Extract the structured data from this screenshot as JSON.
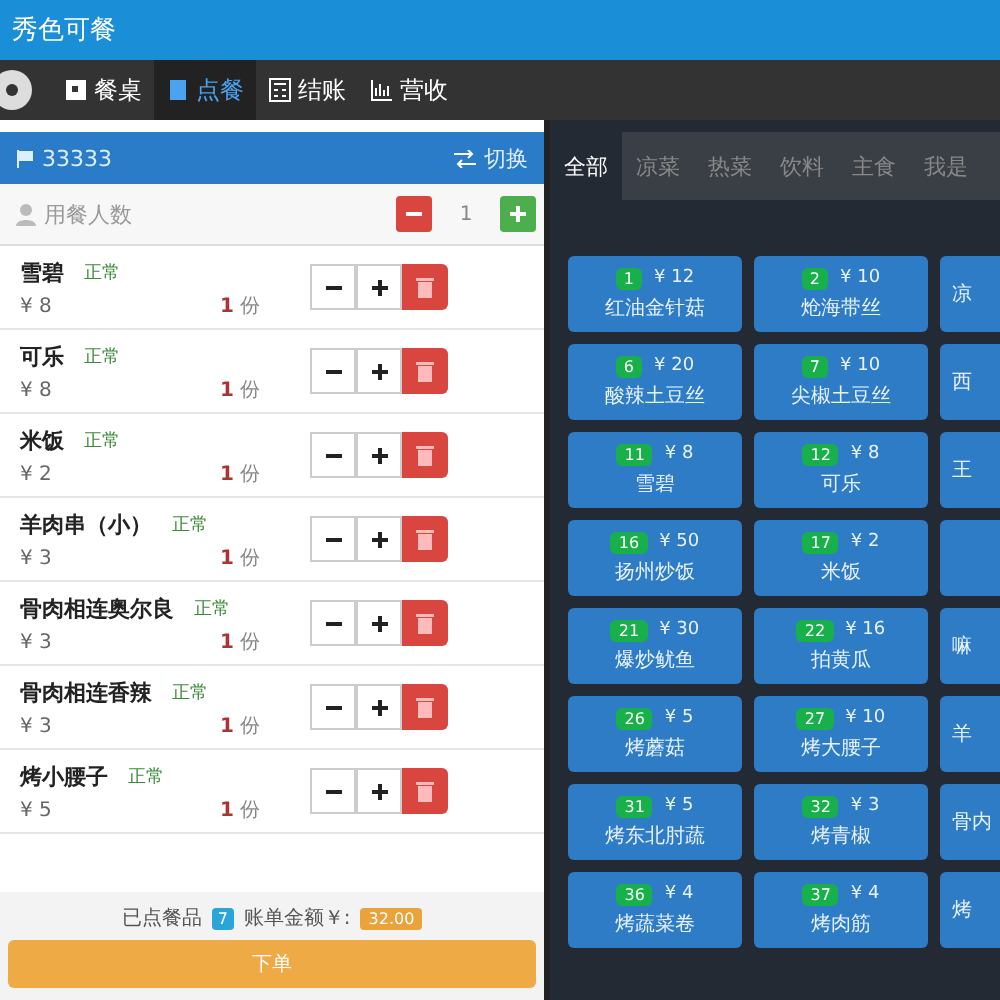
{
  "window": {
    "title": "秀色可餐"
  },
  "nav": [
    {
      "label": "餐桌",
      "selected": false
    },
    {
      "label": "点餐",
      "selected": true
    },
    {
      "label": "结账",
      "selected": false
    },
    {
      "label": "营收",
      "selected": false
    }
  ],
  "order": {
    "table": "33333",
    "switch": "切换",
    "guests_label": "用餐人数",
    "guests": "1",
    "items": [
      {
        "name": "雪碧",
        "status": "正常",
        "price": "¥ 8",
        "qty": "1",
        "unit": "份"
      },
      {
        "name": "可乐",
        "status": "正常",
        "price": "¥ 8",
        "qty": "1",
        "unit": "份"
      },
      {
        "name": "米饭",
        "status": "正常",
        "price": "¥ 2",
        "qty": "1",
        "unit": "份"
      },
      {
        "name": "羊肉串（小）",
        "status": "正常",
        "price": "¥ 3",
        "qty": "1",
        "unit": "份"
      },
      {
        "name": "骨肉相连奥尔良",
        "status": "正常",
        "price": "¥ 3",
        "qty": "1",
        "unit": "份"
      },
      {
        "name": "骨肉相连香辣",
        "status": "正常",
        "price": "¥ 3",
        "qty": "1",
        "unit": "份"
      },
      {
        "name": "烤小腰子",
        "status": "正常",
        "price": "¥ 5",
        "qty": "1",
        "unit": "份"
      }
    ],
    "count_label": "已点餐品",
    "count": "7",
    "total_label": "账单金额￥:",
    "total": "32.00",
    "submit": "下单"
  },
  "tabs": [
    {
      "label": "全部",
      "selected": true
    },
    {
      "label": "凉菜",
      "selected": false
    },
    {
      "label": "热菜",
      "selected": false
    },
    {
      "label": "饮料",
      "selected": false
    },
    {
      "label": "主食",
      "selected": false
    },
    {
      "label": "我是",
      "selected": false
    }
  ],
  "dish_rows": [
    [
      {
        "no": "1",
        "price": "¥ 12",
        "name": "红油金针菇"
      },
      {
        "no": "2",
        "price": "¥ 10",
        "name": "炝海带丝"
      },
      {
        "name": "凉"
      }
    ],
    [
      {
        "no": "6",
        "price": "¥ 20",
        "name": "酸辣土豆丝"
      },
      {
        "no": "7",
        "price": "¥ 10",
        "name": "尖椒土豆丝"
      },
      {
        "name": "西"
      }
    ],
    [
      {
        "no": "11",
        "price": "¥ 8",
        "name": "雪碧"
      },
      {
        "no": "12",
        "price": "¥ 8",
        "name": "可乐"
      },
      {
        "name": "王"
      }
    ],
    [
      {
        "no": "16",
        "price": "¥ 50",
        "name": "扬州炒饭"
      },
      {
        "no": "17",
        "price": "¥ 2",
        "name": "米饭"
      }
    ],
    [
      {
        "no": "21",
        "price": "¥ 30",
        "name": "爆炒鱿鱼"
      },
      {
        "no": "22",
        "price": "¥ 16",
        "name": "拍黄瓜"
      },
      {
        "name": "嘛"
      }
    ],
    [
      {
        "no": "26",
        "price": "¥ 5",
        "name": "烤蘑菇"
      },
      {
        "no": "27",
        "price": "¥ 10",
        "name": "烤大腰子"
      },
      {
        "name": "羊"
      }
    ],
    [
      {
        "no": "31",
        "price": "¥ 5",
        "name": "烤东北肘蔬"
      },
      {
        "no": "32",
        "price": "¥ 3",
        "name": "烤青椒"
      },
      {
        "name": "骨内"
      }
    ],
    [
      {
        "no": "36",
        "price": "¥ 4",
        "name": "烤蔬菜卷"
      },
      {
        "no": "37",
        "price": "¥ 4",
        "name": "烤肉筋"
      },
      {
        "name": "烤"
      }
    ]
  ]
}
